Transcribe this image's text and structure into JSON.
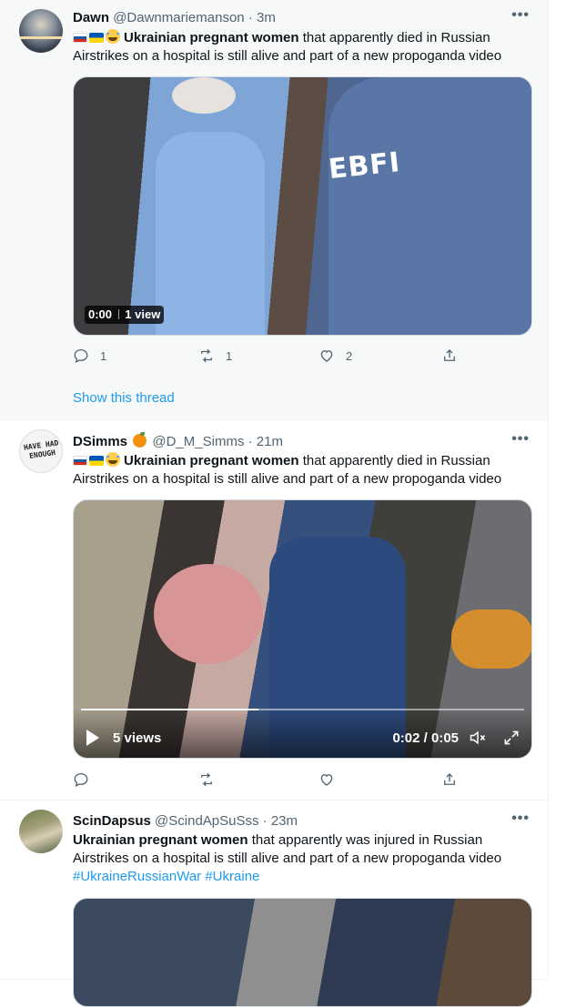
{
  "tweets": [
    {
      "name": "Dawn",
      "handle": "@Dawnmariemanson",
      "time": "· 3m",
      "text_bold": "Ukrainian pregnant women",
      "text_rest": " that apparently died in Russian Airstrikes on a hospital is still alive and part of a new propoganda video",
      "media_text": "EBFI",
      "video_time": "0:00",
      "video_views": "1 view",
      "replies": "1",
      "retweets": "1",
      "likes": "2",
      "show_thread": "Show this thread"
    },
    {
      "name": "DSimms",
      "handle": "@D_M_Simms",
      "time": "· 21m",
      "text_bold": "Ukrainian pregnant women",
      "text_rest": " that apparently died in Russian Airstrikes on a hospital is still alive and part of a new propoganda video",
      "avatar_text": "HAVE HAD ENOUGH",
      "video_views": "5 views",
      "video_time": "0:02 / 0:05",
      "video_progress": 0.4
    },
    {
      "name": "ScinDapsus",
      "handle": "@ScindApSuSss",
      "time": "· 23m",
      "text_bold": "Ukrainian pregnant women",
      "text_rest": " that apparently was injured in Russian Airstrikes on a hospital is still alive and part of a new propoganda video",
      "hashtag1": "#UkraineRussianWar",
      "hashtag2": "#Ukraine"
    }
  ],
  "icons": {
    "more": "more-icon",
    "reply": "reply-icon",
    "retweet": "retweet-icon",
    "like": "like-icon",
    "share": "share-icon"
  },
  "colors": {
    "link": "#1d9bf0",
    "muted": "#536471",
    "hover_bg": "#f7f9f9"
  }
}
